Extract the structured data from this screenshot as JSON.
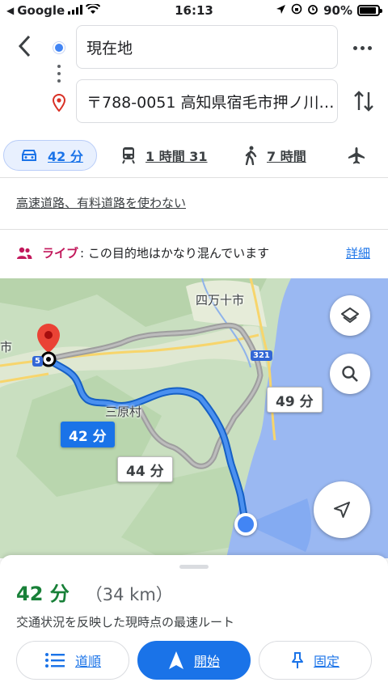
{
  "status_bar": {
    "carrier": "Google",
    "time": "16:13",
    "battery": "90%",
    "battery_level": 0.9
  },
  "directions": {
    "origin": "現在地",
    "destination": "〒788-0051 高知県宿毛市押ノ川…"
  },
  "modes": [
    {
      "name": "car",
      "label": "42 分"
    },
    {
      "name": "transit",
      "label": "1 時間 31"
    },
    {
      "name": "walk",
      "label": "7 時間"
    },
    {
      "name": "flight",
      "label": ""
    }
  ],
  "avoid_option": "高速道路、有料道路を使わない",
  "live": {
    "label": "ライブ",
    "message": ": この目的地はかなり混んでいます",
    "detail_link": "詳細"
  },
  "map": {
    "labels": {
      "town": "四万十市",
      "village": "三原村",
      "edge_city": "市"
    },
    "road_numbers": {
      "route_321": "321",
      "route_5": "5"
    },
    "route_labels": {
      "main": "42 分",
      "alt_1": "49 分",
      "alt_2": "44 分"
    },
    "colors": {
      "route_main": "#1a73e8",
      "route_alt": "#9e9e9e",
      "sea": "#9ab8f2",
      "land": "#c9dfc0",
      "destination_pin": "#ea4335"
    }
  },
  "summary": {
    "duration": "42 分",
    "distance": "（34 km）",
    "note": "交通状況を反映した現時点の最速ルート",
    "buttons": {
      "steps": "道順",
      "start": "開始",
      "pin": "固定"
    }
  }
}
